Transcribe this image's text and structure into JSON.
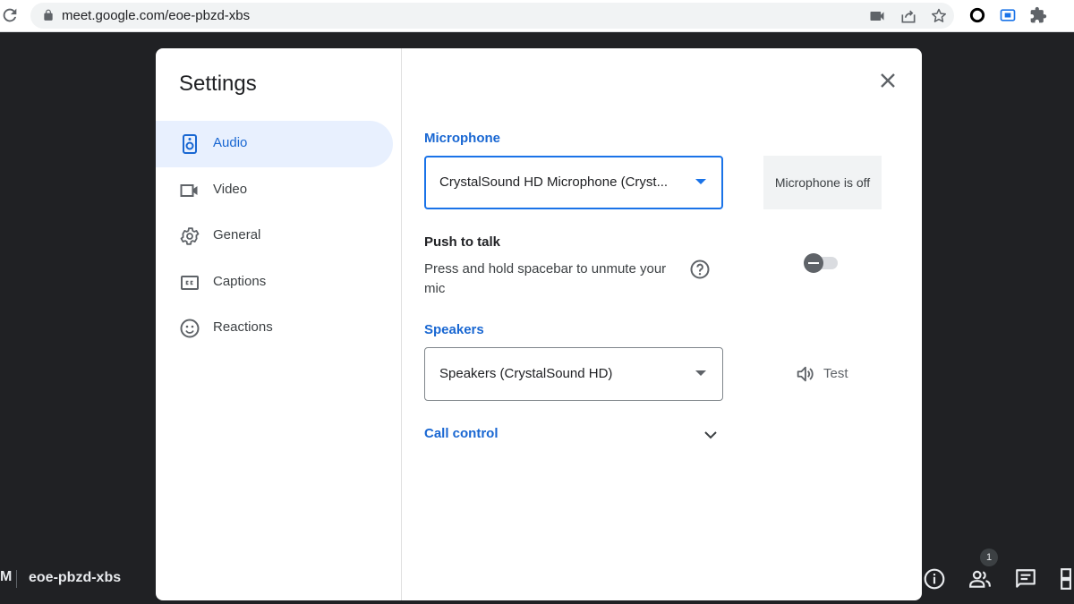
{
  "browser": {
    "url": "meet.google.com/eoe-pbzd-xbs"
  },
  "meeting": {
    "truncated_time": "M",
    "code": "eoe-pbzd-xbs",
    "participant_count": "1"
  },
  "dialog": {
    "title": "Settings",
    "nav": [
      {
        "label": "Audio",
        "icon": "speaker-icon",
        "active": true
      },
      {
        "label": "Video",
        "icon": "videocam-icon",
        "active": false
      },
      {
        "label": "General",
        "icon": "gear-icon",
        "active": false
      },
      {
        "label": "Captions",
        "icon": "closed-caption-icon",
        "active": false
      },
      {
        "label": "Reactions",
        "icon": "smiley-icon",
        "active": false
      }
    ],
    "microphone": {
      "label": "Microphone",
      "selected": "CrystalSound HD Microphone (Cryst...",
      "status": "Microphone is off"
    },
    "push_to_talk": {
      "title": "Push to talk",
      "description": "Press and hold spacebar to unmute your mic",
      "enabled": false
    },
    "speakers": {
      "label": "Speakers",
      "selected": "Speakers (CrystalSound HD)",
      "test_label": "Test"
    },
    "call_control": {
      "label": "Call control"
    }
  },
  "colors": {
    "accent": "#1967d2",
    "active_nav_bg": "#e8f0fe",
    "page_bg": "#202124"
  }
}
